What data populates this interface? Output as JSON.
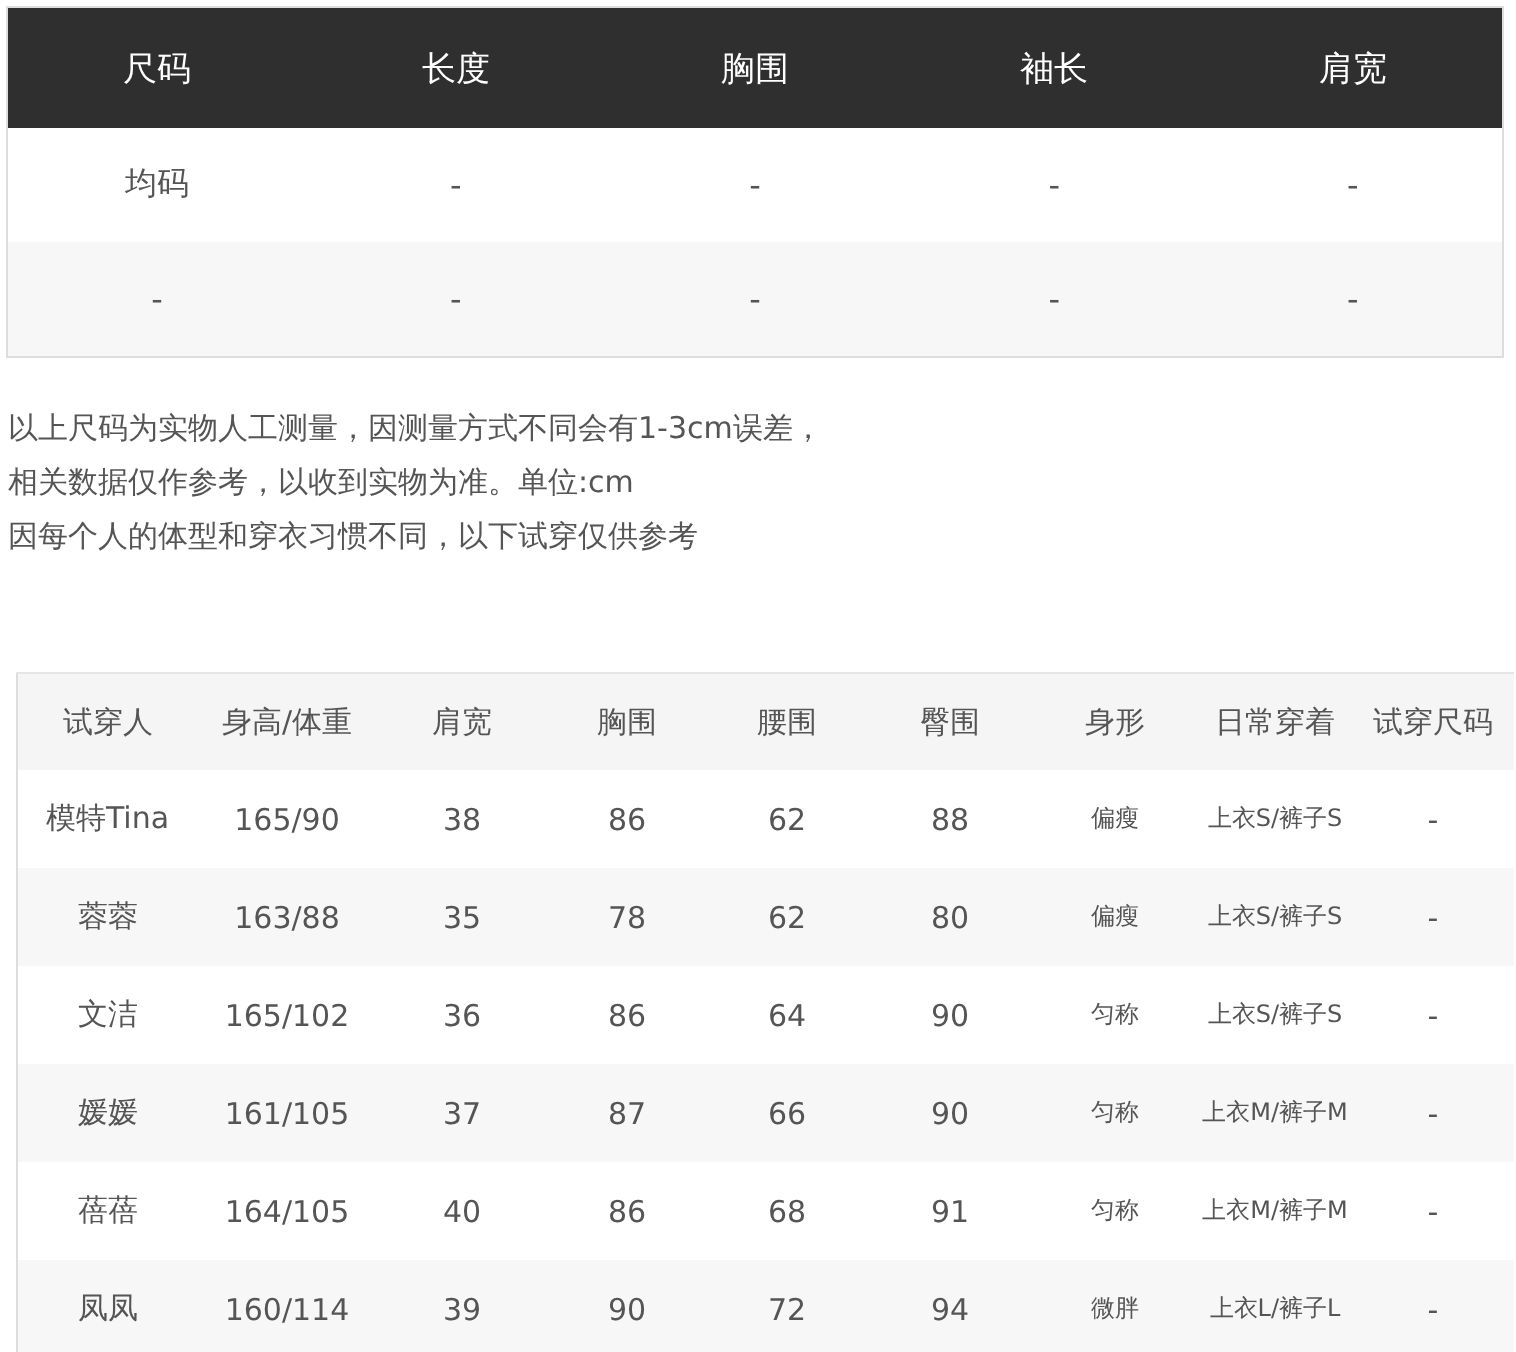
{
  "size_table": {
    "columns": [
      "尺码",
      "长度",
      "胸围",
      "袖长",
      "肩宽"
    ],
    "rows": [
      [
        "均码",
        "-",
        "-",
        "-",
        "-"
      ],
      [
        "-",
        "-",
        "-",
        "-",
        "-"
      ]
    ]
  },
  "notes": [
    "以上尺码为实物人工测量，因测量方式不同会有1-3cm误差，",
    "相关数据仅作参考，以收到实物为准。单位:cm",
    "因每个人的体型和穿衣习惯不同，以下试穿仅供参考"
  ],
  "fit_table": {
    "columns": [
      "试穿人",
      "身高/体重",
      "肩宽",
      "胸围",
      "腰围",
      "臀围",
      "身形",
      "日常穿着",
      "试穿尺码"
    ],
    "rows": [
      [
        "模特Tina",
        "165/90",
        "38",
        "86",
        "62",
        "88",
        "偏瘦",
        "上衣S/裤子S",
        "-"
      ],
      [
        "蓉蓉",
        "163/88",
        "35",
        "78",
        "62",
        "80",
        "偏瘦",
        "上衣S/裤子S",
        "-"
      ],
      [
        "文洁",
        "165/102",
        "36",
        "86",
        "64",
        "90",
        "匀称",
        "上衣S/裤子S",
        "-"
      ],
      [
        "媛媛",
        "161/105",
        "37",
        "87",
        "66",
        "90",
        "匀称",
        "上衣M/裤子M",
        "-"
      ],
      [
        "蓓蓓",
        "164/105",
        "40",
        "86",
        "68",
        "91",
        "匀称",
        "上衣M/裤子M",
        "-"
      ],
      [
        "凤凤",
        "160/114",
        "39",
        "90",
        "72",
        "94",
        "微胖",
        "上衣L/裤子L",
        "-"
      ]
    ]
  }
}
